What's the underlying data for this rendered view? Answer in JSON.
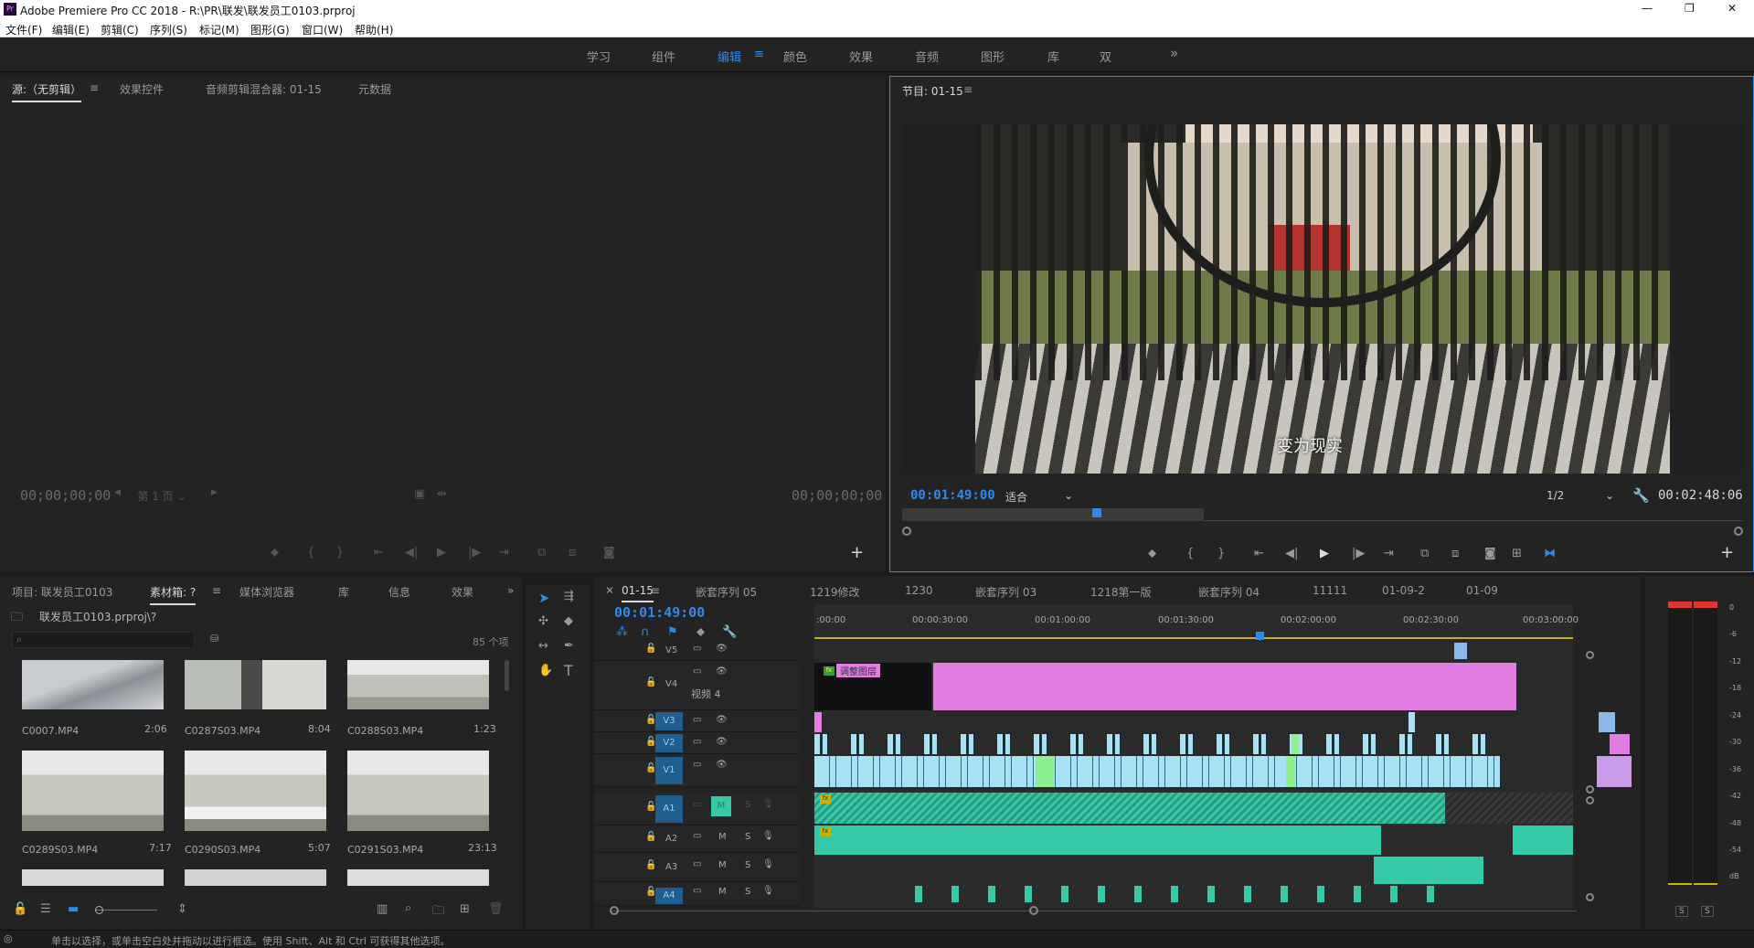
{
  "app": {
    "title": "Adobe Premiere Pro CC 2018 - R:\\PR\\联发\\联发员工0103.prproj",
    "logo": "Pr"
  },
  "window_controls": {
    "minimize": "—",
    "maximize": "❐",
    "close": "✕"
  },
  "menu": [
    "文件(F)",
    "编辑(E)",
    "剪辑(C)",
    "序列(S)",
    "标记(M)",
    "图形(G)",
    "窗口(W)",
    "帮助(H)"
  ],
  "workspaces": {
    "items": [
      "学习",
      "组件",
      "编辑",
      "颜色",
      "效果",
      "音频",
      "图形",
      "库",
      "双"
    ],
    "active": "编辑",
    "more": "»"
  },
  "source_panel": {
    "tabs": [
      "源:（无剪辑）",
      "效果控件",
      "音频剪辑混合器: 01-15",
      "元数据"
    ],
    "tc_left": "00;00;00;00",
    "tc_right": "00;00;00;00",
    "page": "第 1 页"
  },
  "program_panel": {
    "title": "节目: 01-15",
    "timecode": "00:01:49:00",
    "fit": "适合",
    "quality": "1/2",
    "duration": "00:02:48:06",
    "subtitle": "变为现实"
  },
  "project_panel": {
    "tabs": [
      "项目: 联发员工0103",
      "素材箱: ?",
      "媒体浏览器",
      "库",
      "信息",
      "效果"
    ],
    "path": "联发员工0103.prproj\\?",
    "count": "85 个项",
    "clips": [
      {
        "name": "C0007.MP4",
        "dur": "2:06"
      },
      {
        "name": "C0287S03.MP4",
        "dur": "8:04"
      },
      {
        "name": "C0288S03.MP4",
        "dur": "1:23"
      },
      {
        "name": "C0289S03.MP4",
        "dur": "7:17"
      },
      {
        "name": "C0290S03.MP4",
        "dur": "5:07"
      },
      {
        "name": "C0291S03.MP4",
        "dur": "23:13"
      }
    ]
  },
  "timeline": {
    "tabs": [
      "01-15",
      "嵌套序列 05",
      "1219修改",
      "1230",
      "嵌套序列 03",
      "1218第一版",
      "嵌套序列 04",
      "11111",
      "01-09-2",
      "01-09"
    ],
    "timecode": "00:01:49:00",
    "ruler": [
      ":00:00",
      "00:00:30:00",
      "00:01:00:00",
      "00:01:30:00",
      "00:02:00:00",
      "00:02:30:00",
      "00:03:00:00"
    ],
    "tracks": [
      {
        "name": "V5"
      },
      {
        "name": "V4",
        "label": "视频 4"
      },
      {
        "name": "V3"
      },
      {
        "name": "V2"
      },
      {
        "name": "V1"
      },
      {
        "name": "A1"
      },
      {
        "name": "A2"
      },
      {
        "name": "A3"
      },
      {
        "name": "A4"
      }
    ],
    "adj_clip": "调整图层",
    "m": "M",
    "s": "S"
  },
  "meter": {
    "scale": [
      "0",
      "-6",
      "-12",
      "-18",
      "-24",
      "-30",
      "-36",
      "-42",
      "-48",
      "-54",
      "dB"
    ],
    "solo": "S"
  },
  "status": "单击以选择，或单击空白处并拖动以进行框选。使用 Shift、Alt 和 Ctrl 可获得其他选项。",
  "colors": {
    "accent": "#2d8ceb",
    "pink": "#e17ee1",
    "video": "#a7e3f5",
    "audio": "#35c9a8"
  }
}
